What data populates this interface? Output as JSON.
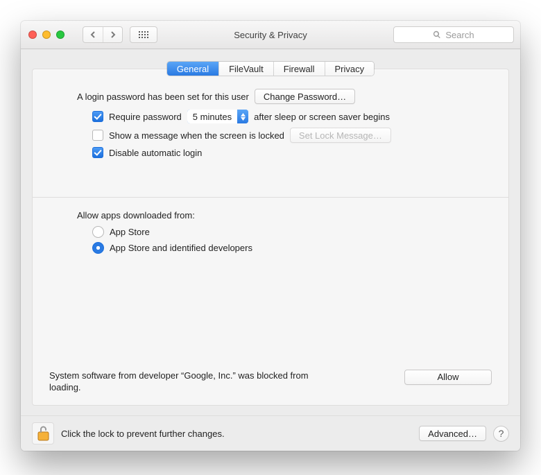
{
  "window": {
    "title": "Security & Privacy"
  },
  "search": {
    "placeholder": "Search"
  },
  "tabs": [
    {
      "label": "General",
      "active": true
    },
    {
      "label": "FileVault",
      "active": false
    },
    {
      "label": "Firewall",
      "active": false
    },
    {
      "label": "Privacy",
      "active": false
    }
  ],
  "password_section": {
    "intro": "A login password has been set for this user",
    "change_button": "Change Password…",
    "require_label_pre": "Require password",
    "require_popup": "5 minutes",
    "require_label_post": "after sleep or screen saver begins",
    "require_checked": true,
    "show_message_label": "Show a message when the screen is locked",
    "show_message_checked": false,
    "set_lock_button": "Set Lock Message…",
    "disable_auto_label": "Disable automatic login",
    "disable_auto_checked": true
  },
  "download_section": {
    "heading": "Allow apps downloaded from:",
    "options": [
      {
        "label": "App Store",
        "selected": false
      },
      {
        "label": "App Store and identified developers",
        "selected": true
      }
    ]
  },
  "blocked_section": {
    "message": "System software from developer “Google, Inc.” was blocked from loading.",
    "allow_button": "Allow"
  },
  "footer": {
    "lock_hint": "Click the lock to prevent further changes.",
    "advanced_button": "Advanced…",
    "help_label": "?"
  }
}
